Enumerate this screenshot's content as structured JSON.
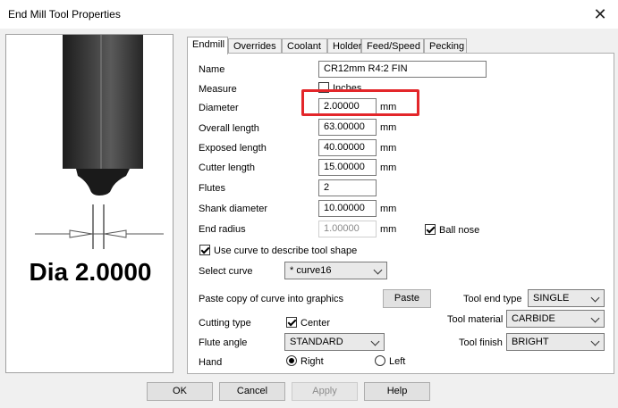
{
  "window": {
    "title": "End Mill Tool Properties",
    "close_glyph": "✕"
  },
  "preview": {
    "dia_text": "Dia 2.0000"
  },
  "tabs": [
    "Endmill",
    "Overrides",
    "Coolant",
    "Holder",
    "Feed/Speed",
    "Pecking"
  ],
  "fields": {
    "name": {
      "label": "Name",
      "value": "CR12mm R4:2 FIN"
    },
    "measure": {
      "label": "Measure",
      "checkbox_label": "Inches",
      "checked": false
    },
    "diameter": {
      "label": "Diameter",
      "value": "2.00000",
      "unit": "mm"
    },
    "overall_length": {
      "label": "Overall length",
      "value": "63.00000",
      "unit": "mm"
    },
    "exposed_length": {
      "label": "Exposed length",
      "value": "40.00000",
      "unit": "mm"
    },
    "cutter_length": {
      "label": "Cutter length",
      "value": "15.00000",
      "unit": "mm"
    },
    "flutes": {
      "label": "Flutes",
      "value": "2"
    },
    "shank_diameter": {
      "label": "Shank diameter",
      "value": "10.00000",
      "unit": "mm"
    },
    "end_radius": {
      "label": "End radius",
      "value": "1.00000",
      "unit": "mm"
    },
    "ball_nose": {
      "label": "Ball nose",
      "checked": true
    }
  },
  "use_curve": {
    "label": "Use curve to describe tool shape",
    "checked": true
  },
  "select_curve": {
    "label": "Select curve",
    "value": "* curve16"
  },
  "paste": {
    "label": "Paste copy of curve into graphics",
    "button": "Paste"
  },
  "cutting_type": {
    "label": "Cutting type",
    "checkbox_label": "Center",
    "checked": true
  },
  "flute_angle": {
    "label": "Flute angle",
    "value": "STANDARD"
  },
  "hand": {
    "label": "Hand",
    "right": "Right",
    "left": "Left",
    "selected": "Right"
  },
  "tool_end_type": {
    "label": "Tool end type",
    "value": "SINGLE"
  },
  "tool_material": {
    "label": "Tool material",
    "value": "CARBIDE"
  },
  "tool_finish": {
    "label": "Tool finish",
    "value": "BRIGHT"
  },
  "buttons": {
    "ok": "OK",
    "cancel": "Cancel",
    "apply": "Apply",
    "help": "Help"
  },
  "colors": {
    "highlight": "#e3262a",
    "tool_body": "#3a3a3a",
    "tool_dark": "#1a1a1a"
  }
}
